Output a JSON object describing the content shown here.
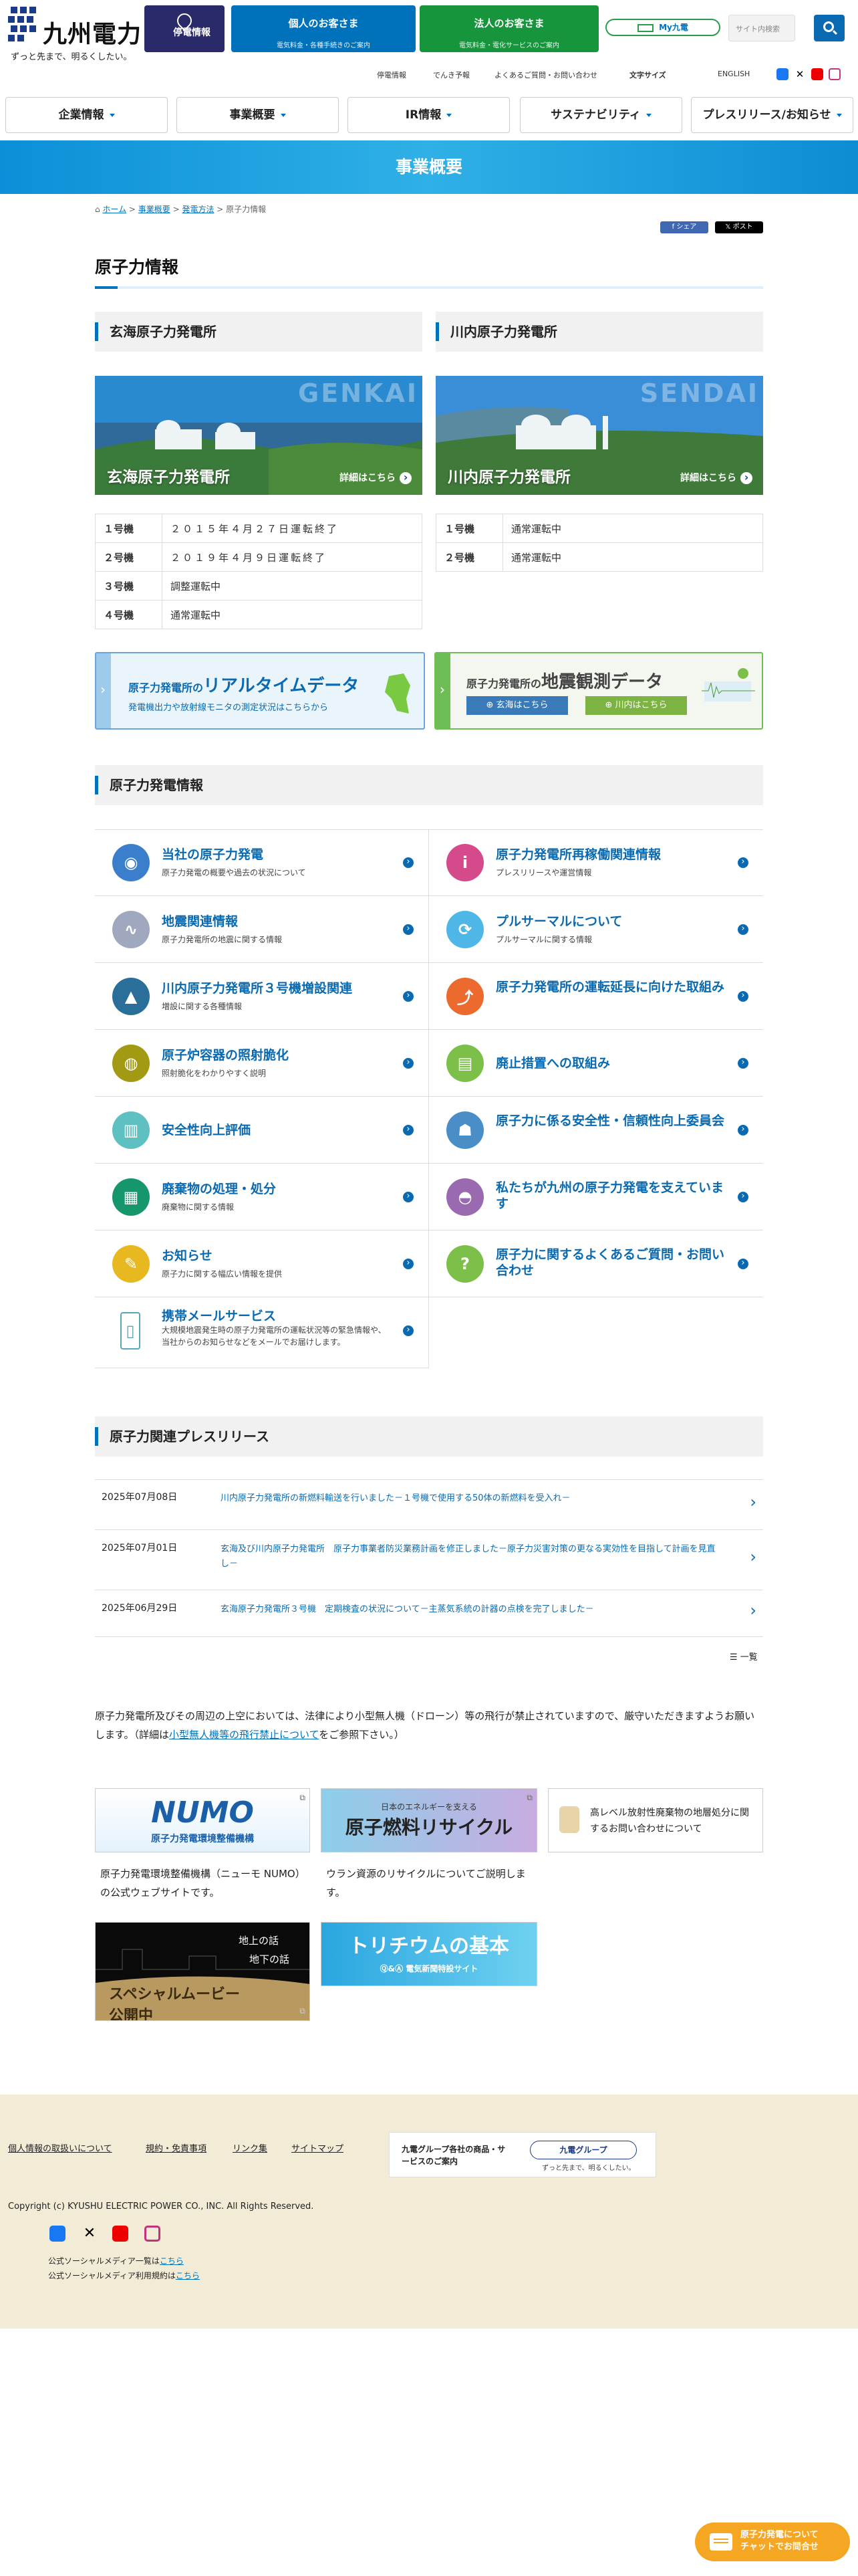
{
  "header": {
    "logo_name": "九州電力",
    "tagline": "ずっと先まで、明るくしたい。",
    "outage": "停電情報",
    "personal": {
      "title": "個人のお客さま",
      "sub": "電気料金・各種手続きのご案内"
    },
    "corporate": {
      "title": "法人のお客さま",
      "sub": "電気料金・電化サービスのご案内"
    },
    "my_kyuden": "My九電",
    "search_placeholder": "サイト内検索"
  },
  "utility_links": [
    "停電情報",
    "でんき予報",
    "よくあるご質問・お問い合わせ",
    "文字サイズ",
    "ENGLISH"
  ],
  "nav": [
    "企業情報",
    "事業概要",
    "IR情報",
    "サステナビリティ",
    "プレスリリース/お知らせ"
  ],
  "band_title": "事業概要",
  "breadcrumb": {
    "home": "ホーム",
    "b1": "事業概要",
    "b2": "発電方法",
    "current": "原子力情報"
  },
  "share": {
    "facebook": "シェア",
    "x": "ポスト"
  },
  "page_title": "原子力情報",
  "plants": [
    {
      "heading": "玄海原子力発電所",
      "img_word": "GENKAI",
      "img_name": "玄海原子力発電所",
      "details": "詳細はこちら",
      "units": [
        {
          "k": "１号機",
          "v": "２０１５年４月２７日運転終了"
        },
        {
          "k": "２号機",
          "v": "２０１９年４月９日運転終了"
        },
        {
          "k": "３号機",
          "v": "調整運転中"
        },
        {
          "k": "４号機",
          "v": "通常運転中"
        }
      ]
    },
    {
      "heading": "川内原子力発電所",
      "img_word": "SENDAI",
      "img_name": "川内原子力発電所",
      "details": "詳細はこちら",
      "units": [
        {
          "k": "１号機",
          "v": "通常運転中"
        },
        {
          "k": "２号機",
          "v": "通常運転中"
        }
      ]
    }
  ],
  "realtime_banner": {
    "pre": "原子力発電所の",
    "em": "リアルタイムデータ",
    "sub": "発電機出力や放射線モニタの測定状況はこちらから"
  },
  "seismic_banner": {
    "pre": "原子力発電所の",
    "em": "地震観測データ",
    "btn1": "玄海はこちら",
    "btn2": "川内はこちら"
  },
  "menu_heading": "原子力発電情報",
  "menu": [
    {
      "title": "当社の原子力発電",
      "sub": "原子力発電の概要や過去の状況について",
      "icon": "reactor-icon",
      "color": "#3b7fcc"
    },
    {
      "title": "原子力発電所再稼働関連情報",
      "sub": "プレスリリースや運営情報",
      "icon": "info-icon",
      "color": "#d44a8a"
    },
    {
      "title": "地震関連情報",
      "sub": "原子力発電所の地震に関する情報",
      "icon": "seismograph-icon",
      "color": "#a0a8c0"
    },
    {
      "title": "プルサーマルについて",
      "sub": "プルサーマルに関する情報",
      "icon": "recycle-icon",
      "color": "#4fb6e8"
    },
    {
      "title": "川内原子力発電所３号機増設関連",
      "sub": "増設に関する各種情報",
      "icon": "plant-photo-icon",
      "color": "#2a6e9a"
    },
    {
      "title": "原子力発電所の運転延長に向けた取組み",
      "sub": "",
      "icon": "extension-icon",
      "color": "#ec6a2d"
    },
    {
      "title": "原子炉容器の照射脆化",
      "sub": "照射脆化をわかりやすく説明",
      "icon": "vessel-icon",
      "color": "#a29a12"
    },
    {
      "title": "廃止措置への取組み",
      "sub": "",
      "icon": "decommission-icon",
      "color": "#7cc04a"
    },
    {
      "title": "安全性向上評価",
      "sub": "",
      "icon": "book-icon",
      "color": "#5ec0c0"
    },
    {
      "title": "原子力に係る安全性・信頼性向上委員会",
      "sub": "",
      "icon": "committee-icon",
      "color": "#4a8ec8"
    },
    {
      "title": "廃棄物の処理・処分",
      "sub": "廃棄物に関する情報",
      "icon": "waste-icon",
      "color": "#16966c"
    },
    {
      "title": "私たちが九州の原子力発電を支えています",
      "sub": "",
      "icon": "worker-icon",
      "color": "#9a6ab0"
    },
    {
      "title": "お知らせ",
      "sub": "原子力に関する幅広い情報を提供",
      "icon": "notice-icon",
      "color": "#e8b820"
    },
    {
      "title": "原子力に関するよくあるご質問・お問い合わせ",
      "sub": "",
      "icon": "question-icon",
      "color": "#7cc04a"
    },
    {
      "title": "携帯メールサービス",
      "sub": "大規模地震発生時の原子力発電所の運転状況等の緊急情報や、当社からのお知らせなどをメールでお届けします。",
      "icon": "mobile-icon",
      "color": "#5aa6b8"
    }
  ],
  "press_heading": "原子力関連プレスリリース",
  "press": [
    {
      "date": "2025年07月08日",
      "text": "川内原子力発電所の新燃料輸送を行いました－１号機で使用する50体の新燃料を受入れ－"
    },
    {
      "date": "2025年07月01日",
      "text": "玄海及び川内原子力発電所　原子力事業者防災業務計画を修正しました－原子力災害対策の更なる実効性を目指して計画を見直し－"
    },
    {
      "date": "2025年06月29日",
      "text": "玄海原子力発電所３号機　定期検査の状況について－主蒸気系統の計器の点検を完了しました－"
    }
  ],
  "press_list": "一覧",
  "notice": {
    "text1": "原子力発電所及びその周辺の上空においては、法律により小型無人機（ドローン）等の飛行が禁止されていますので、厳守いただきますようお願いします。（詳細は",
    "link": "小型無人機等の飛行禁止について",
    "text2": "をご参照下さい。）"
  },
  "banners": {
    "numo_logo": "NUMO",
    "numo_sub": "原子力発電環境整備機構",
    "numo_caption": "原子力発電環境整備機構（ニューモ NUMO）の公式ウェブサイトです。",
    "recycle_small": "日本のエネルギーを支える",
    "recycle_big": "原子燃料リサイクル",
    "recycle_caption": "ウラン資源のリサイクルについてご説明します。",
    "waste_text": "高レベル放射性廃棄物の地層処分に関するお問い合わせについて",
    "movie_a": "スペシャルムービー",
    "movie_b": "公開中",
    "movie_c": "地上の話",
    "movie_d": "地下の話",
    "tritium_title": "トリチウムの基本",
    "tritium_sub": "電気新聞特設サイト"
  },
  "footer": {
    "links": [
      "個人情報の取扱いについて",
      "規約・免責事項",
      "リンク集",
      "サイトマップ"
    ],
    "group_text": "九電グループ各社の商品・サービスのご案内",
    "group_logo": "九電グループ",
    "group_tag": "ずっと先まで、明るくしたい。",
    "copyright": "Copyright (c) KYUSHU ELECTRIC POWER CO., INC. All Rights Reserved.",
    "sm1": "公式ソーシャルメディア一覧は",
    "sm2": "公式ソーシャルメディア利用規約は",
    "here": "こちら"
  },
  "chat": {
    "line1": "原子力発電について",
    "line2": "チャットでお問合せ"
  },
  "colors": {
    "brand_blue": "#0072bc",
    "brand_green": "#16953c",
    "navy": "#2a2a6a",
    "footer_bg": "#f2ebd5"
  }
}
